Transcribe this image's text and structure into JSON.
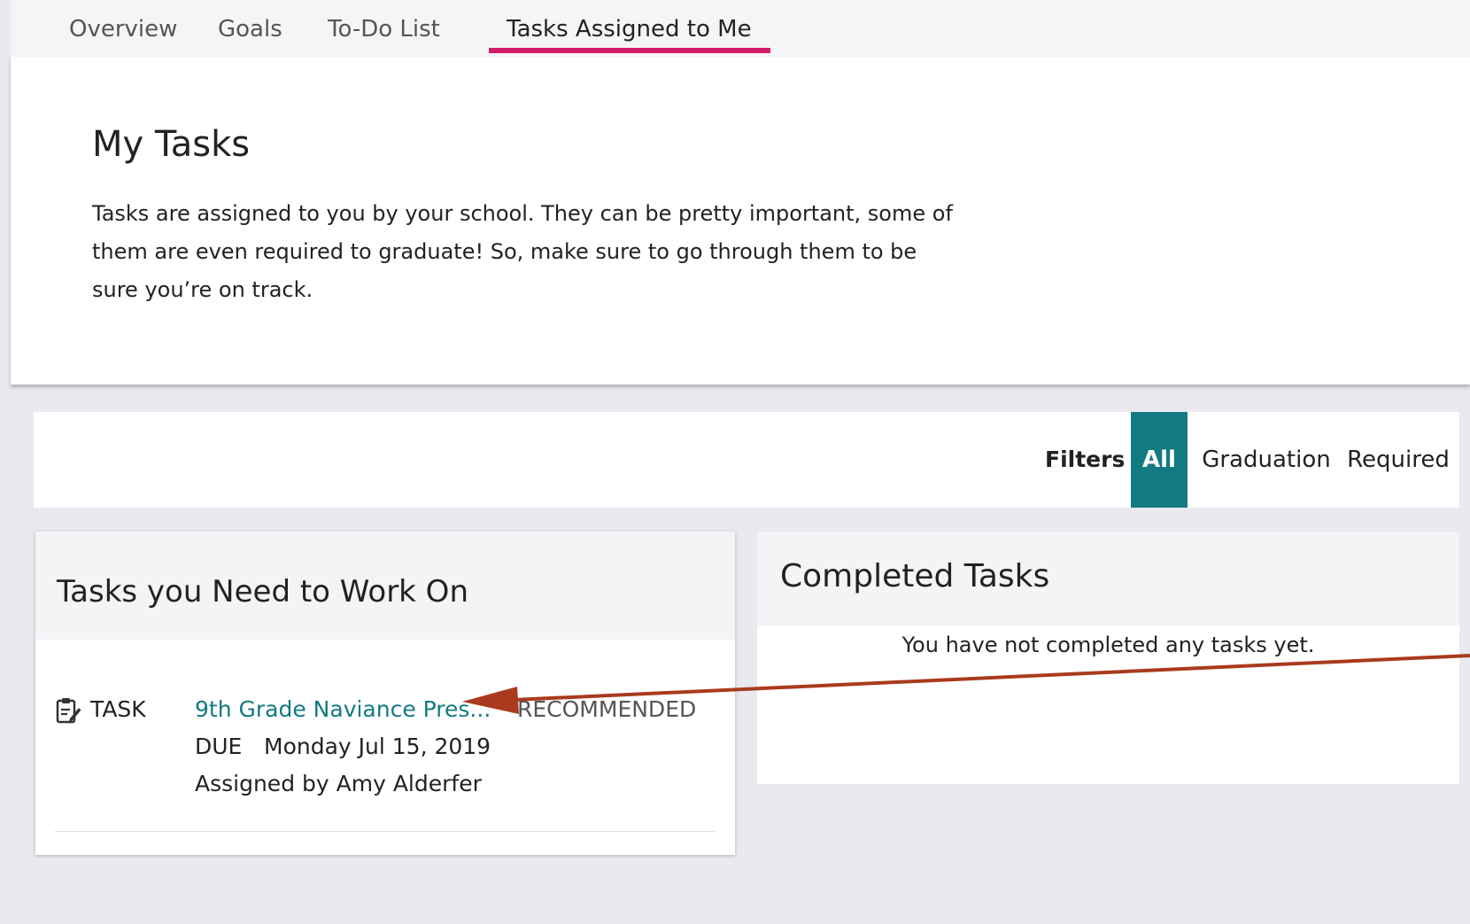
{
  "tabs": [
    {
      "label": "Overview",
      "active": false
    },
    {
      "label": "Goals",
      "active": false
    },
    {
      "label": "To-Do List",
      "active": false
    },
    {
      "label": "Tasks Assigned to Me",
      "active": true
    }
  ],
  "hero": {
    "title": "My Tasks",
    "description": "Tasks are assigned to you by your school. They can be pretty important, some of them are even required to graduate! So, make sure to go through them to be sure you’re on track."
  },
  "filters": {
    "label": "Filters",
    "options": [
      {
        "label": "All",
        "active": true
      },
      {
        "label": "Graduation",
        "active": false
      },
      {
        "label": "Required",
        "active": false
      }
    ]
  },
  "tasks_panel": {
    "title": "Tasks you Need to Work On",
    "task": {
      "icon": "clipboard-edit-icon",
      "type": "TASK",
      "name": "9th Grade Naviance Pres...",
      "status": "RECOMMENDED",
      "due_label": "DUE",
      "due_date": "Monday Jul 15, 2019",
      "assigned_by": "Assigned by Amy Alderfer"
    }
  },
  "completed_panel": {
    "title": "Completed Tasks",
    "empty_message": "You have not completed any tasks yet."
  },
  "colors": {
    "accent": "#127b82",
    "tab_underline": "#d21c6b",
    "annotation_arrow": "#a93a1d"
  }
}
